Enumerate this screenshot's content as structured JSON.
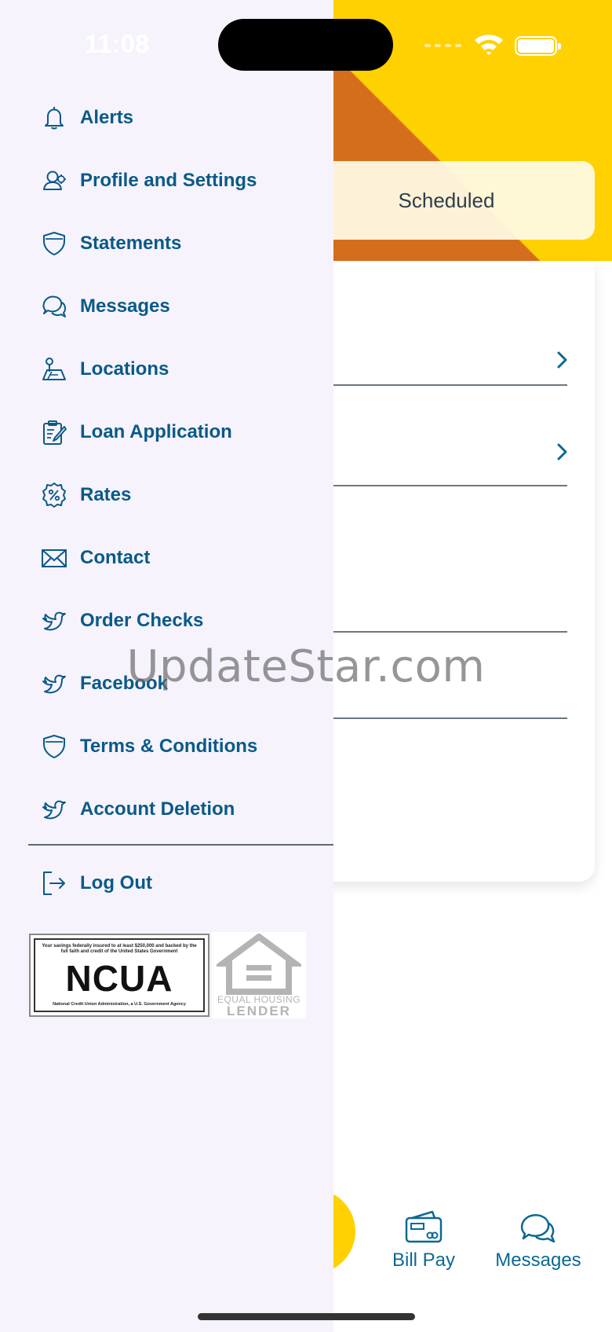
{
  "status_bar": {
    "time": "11:08"
  },
  "background_app": {
    "scheduled_label": "Scheduled",
    "bottom_tabs": [
      {
        "label": "Bill Pay",
        "icon": "bill-pay-icon"
      },
      {
        "label": "Messages",
        "icon": "messages-icon"
      }
    ]
  },
  "drawer": {
    "menu_items": [
      {
        "label": "Alerts",
        "icon": "bell-icon"
      },
      {
        "label": "Profile and Settings",
        "icon": "profile-icon"
      },
      {
        "label": "Statements",
        "icon": "shield-icon"
      },
      {
        "label": "Messages",
        "icon": "chat-bubbles-icon"
      },
      {
        "label": "Locations",
        "icon": "map-pin-icon"
      },
      {
        "label": "Loan Application",
        "icon": "clipboard-edit-icon"
      },
      {
        "label": "Rates",
        "icon": "percent-badge-icon"
      },
      {
        "label": "Contact",
        "icon": "envelope-icon"
      },
      {
        "label": "Order Checks",
        "icon": "bird-icon"
      },
      {
        "label": "Facebook",
        "icon": "bird-icon"
      },
      {
        "label": "Terms & Conditions",
        "icon": "shield-icon"
      },
      {
        "label": "Account Deletion",
        "icon": "bird-icon"
      }
    ],
    "logout": {
      "label": "Log Out",
      "icon": "logout-icon"
    },
    "ncua": {
      "top_text": "Your savings federally insured to at least $250,000 and backed by the full faith and credit of the United States Government",
      "word": "NCUA",
      "bottom_text": "National Credit Union Administration, a U.S. Government Agency"
    },
    "equal_housing": {
      "line1": "EQUAL HOUSING",
      "line2": "LENDER"
    }
  },
  "watermark": "UpdateStar.com",
  "colors": {
    "drawer_bg": "#f6f3fd",
    "menu_text": "#0a5a86",
    "hero_orange": "#d56e1c",
    "hero_yellow": "#ffd100",
    "tab_blue": "#0b6894"
  }
}
